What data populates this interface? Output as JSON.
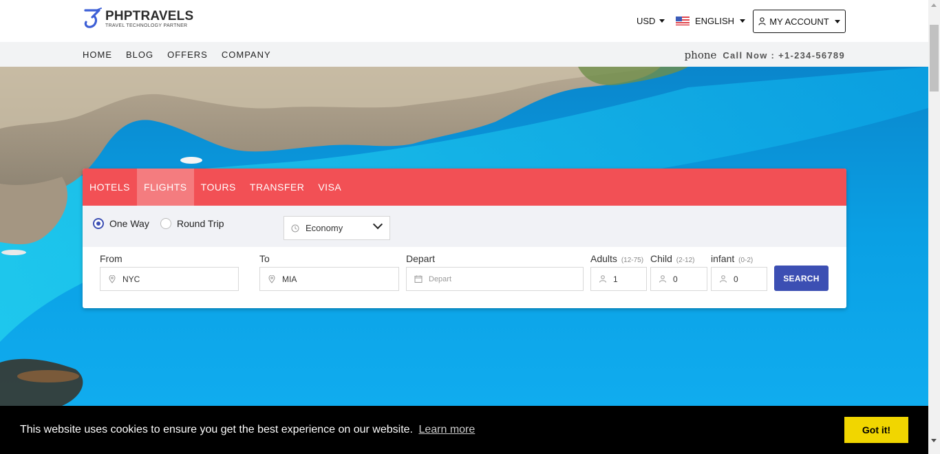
{
  "header": {
    "logo_title": "PHPTRAVELS",
    "logo_subtitle": "TRAVEL TECHNOLOGY PARTNER",
    "currency": "USD",
    "language": "ENGLISH",
    "account": "MY ACCOUNT"
  },
  "nav": {
    "items": [
      "HOME",
      "BLOG",
      "OFFERS",
      "COMPANY"
    ],
    "phone_icon_text": "phone",
    "call_label": "Call Now : +1-234-56789"
  },
  "search": {
    "tabs": [
      "HOTELS",
      "FLIGHTS",
      "TOURS",
      "TRANSFER",
      "VISA"
    ],
    "active_tab": "FLIGHTS",
    "trip_types": [
      "One Way",
      "Round Trip"
    ],
    "selected_trip": "One Way",
    "cabin_class": "Economy",
    "from_label": "From",
    "from_value": "NYC",
    "to_label": "To",
    "to_value": "MIA",
    "depart_label": "Depart",
    "depart_placeholder": "Depart",
    "adults_label": "Adults",
    "adults_range": "(12-75)",
    "adults_value": "1",
    "child_label": "Child",
    "child_range": "(2-12)",
    "child_value": "0",
    "infant_label": "infant",
    "infant_range": "(0-2)",
    "infant_value": "0",
    "search_button": "SEARCH"
  },
  "cookie": {
    "message": "This website uses cookies to ensure you get the best experience on our website.",
    "learn_more": "Learn more",
    "button": "Got it!"
  },
  "colors": {
    "tab_bar": "#f25055",
    "tab_active": "#f47c7f",
    "primary": "#3c4fb3",
    "cookie_button": "#f1d600"
  },
  "icons": {
    "logo": "phptravels-logo-icon",
    "flag": "us-flag-icon",
    "account": "user-icon",
    "location": "location-pin-icon",
    "calendar": "calendar-icon",
    "clock": "clock-icon",
    "person": "person-icon"
  }
}
